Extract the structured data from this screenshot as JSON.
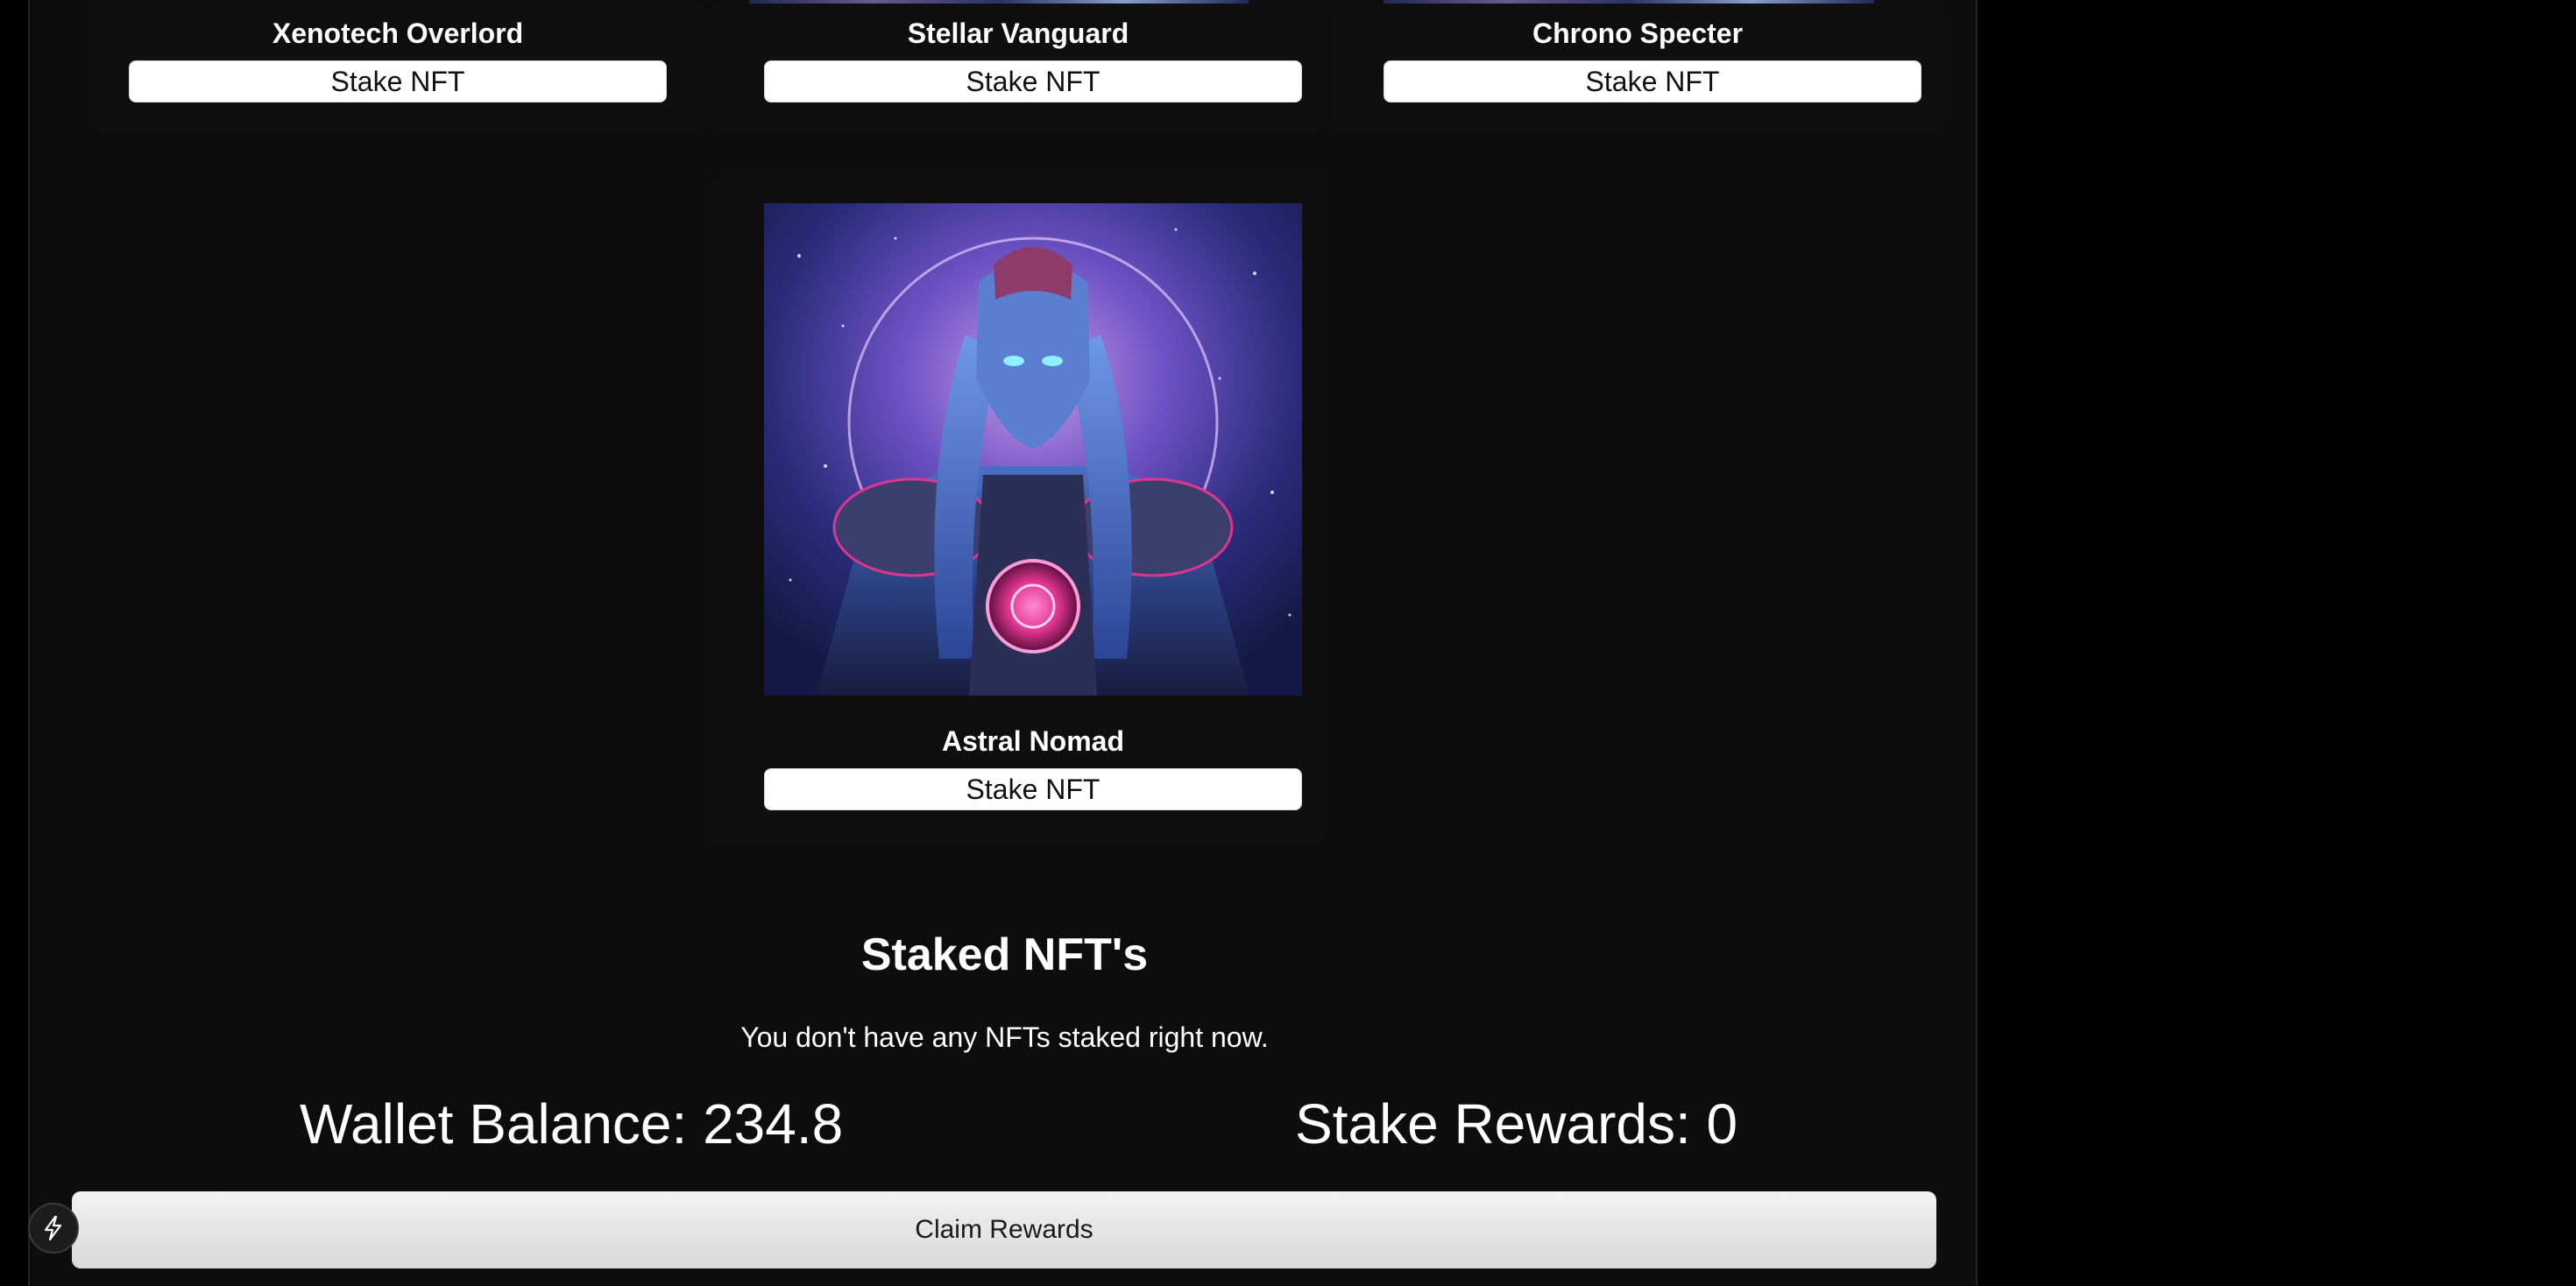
{
  "gallery": {
    "cards": [
      {
        "name": "Xenotech Overlord",
        "button_label": "Stake NFT"
      },
      {
        "name": "Stellar Vanguard",
        "button_label": "Stake NFT"
      },
      {
        "name": "Chrono Specter",
        "button_label": "Stake NFT"
      },
      {
        "name": "Astral Nomad",
        "button_label": "Stake NFT"
      }
    ]
  },
  "staked": {
    "title": "Staked NFT's",
    "empty_message": "You don't have any NFTs staked right now."
  },
  "stats": {
    "wallet_balance": "Wallet Balance: 234.8",
    "stake_rewards": "Stake Rewards: 0"
  },
  "actions": {
    "claim_label": "Claim Rewards"
  },
  "colors": {
    "page_background": "#000000",
    "panel_background": "#0d0d0d",
    "button_background": "#ffffff",
    "text": "#ffffff",
    "art_accent": "#e0358f"
  },
  "icons": {
    "fab": "lightning-bolt-icon"
  }
}
